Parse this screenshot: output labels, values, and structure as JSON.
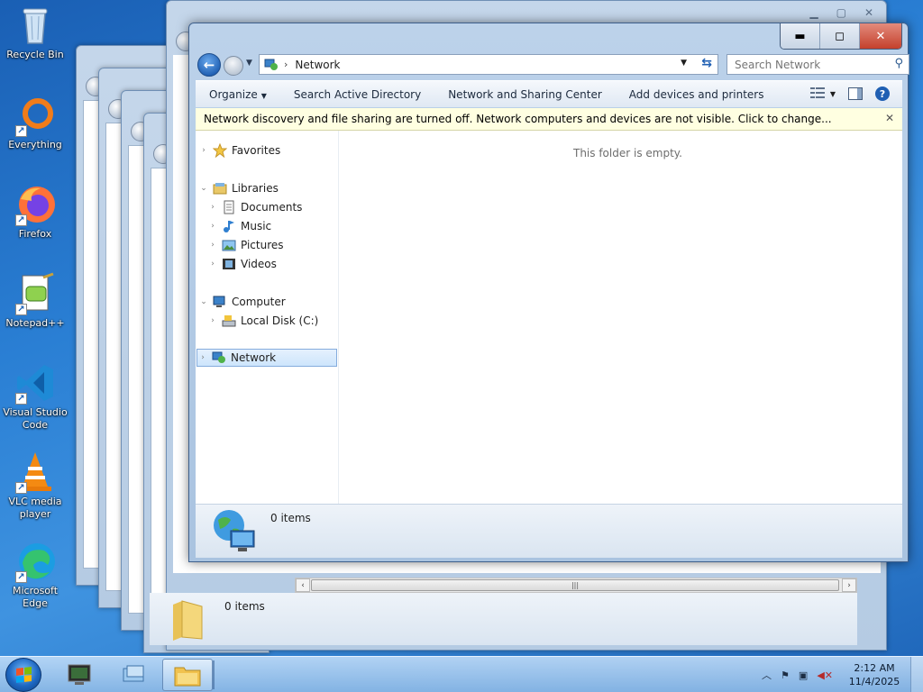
{
  "desktop": {
    "icons": [
      {
        "label": "Recycle Bin"
      },
      {
        "label": "Everything"
      },
      {
        "label": "Firefox"
      },
      {
        "label": "Notepad++"
      },
      {
        "label": "Visual Studio Code"
      },
      {
        "label": "VLC media player"
      },
      {
        "label": "Microsoft Edge"
      }
    ]
  },
  "window": {
    "address": {
      "location": "Network"
    },
    "search": {
      "placeholder": "Search Network"
    },
    "commands": {
      "organize": "Organize",
      "search_ad": "Search Active Directory",
      "network_center": "Network and Sharing Center",
      "add_devices": "Add devices and printers"
    },
    "info_bar": "Network discovery and file sharing are turned off. Network computers and devices are not visible. Click to change...",
    "nav_tree": {
      "favorites": "Favorites",
      "libraries": "Libraries",
      "documents": "Documents",
      "music": "Music",
      "pictures": "Pictures",
      "videos": "Videos",
      "computer": "Computer",
      "local_disk": "Local Disk (C:)",
      "network": "Network"
    },
    "empty_message": "This folder is empty.",
    "details": {
      "count": "0 items"
    }
  },
  "background_window": {
    "details": {
      "count": "0 items"
    }
  },
  "taskbar": {
    "clock_time": "2:12 AM",
    "clock_date": "11/4/2025"
  },
  "colors": {
    "accent": "#1f5fb3",
    "info_bar_bg": "#ffffe1",
    "close_button": "#c4402c"
  }
}
